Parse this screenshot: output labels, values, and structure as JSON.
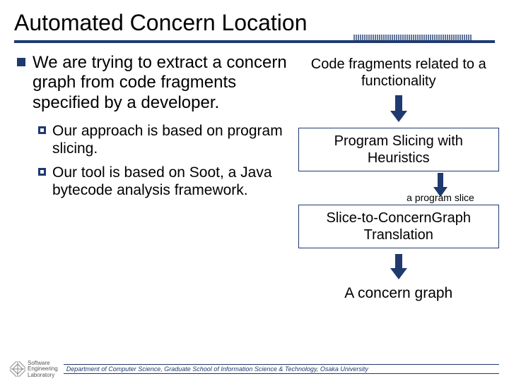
{
  "title": "Automated Concern Location",
  "bullet1": "We are trying to extract a concern graph from code fragments specified by a developer.",
  "sub1": "Our approach is based on program slicing.",
  "sub2": "Our tool is based on Soot, a Java bytecode analysis framework.",
  "right": {
    "input": "Code fragments related to a functionality",
    "box1": "Program Slicing with Heuristics",
    "note": "a program slice",
    "box2": "Slice-to-ConcernGraph Translation",
    "output": "A concern graph"
  },
  "footer": {
    "logo_line1": "Software",
    "logo_line2": "Engineering",
    "logo_line3": "Laboratory",
    "dept": "Department of Computer Science, Graduate School of Information Science & Technology, Osaka University"
  },
  "colors": {
    "accent": "#1f3a6e"
  }
}
